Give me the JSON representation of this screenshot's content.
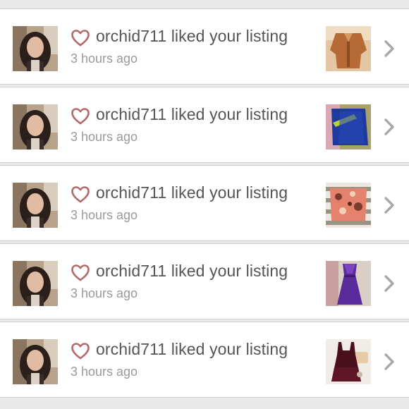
{
  "notifications": [
    {
      "text": "orchid711 liked your listing",
      "time": "3 hours ago",
      "thumb": "thumb-1"
    },
    {
      "text": "orchid711 liked your listing",
      "time": "3 hours ago",
      "thumb": "thumb-2"
    },
    {
      "text": "orchid711 liked your listing",
      "time": "3 hours ago",
      "thumb": "thumb-3"
    },
    {
      "text": "orchid711 liked your listing",
      "time": "3 hours ago",
      "thumb": "thumb-4"
    },
    {
      "text": "orchid711 liked your listing",
      "time": "3 hours ago",
      "thumb": "thumb-5"
    }
  ],
  "colors": {
    "heart": "#b46a6a",
    "title": "#555555",
    "time": "#9a9a9a",
    "chevron": "#a8a8a8"
  },
  "icons": {
    "heart": "heart-icon",
    "chevron": "chevron-right-icon"
  }
}
